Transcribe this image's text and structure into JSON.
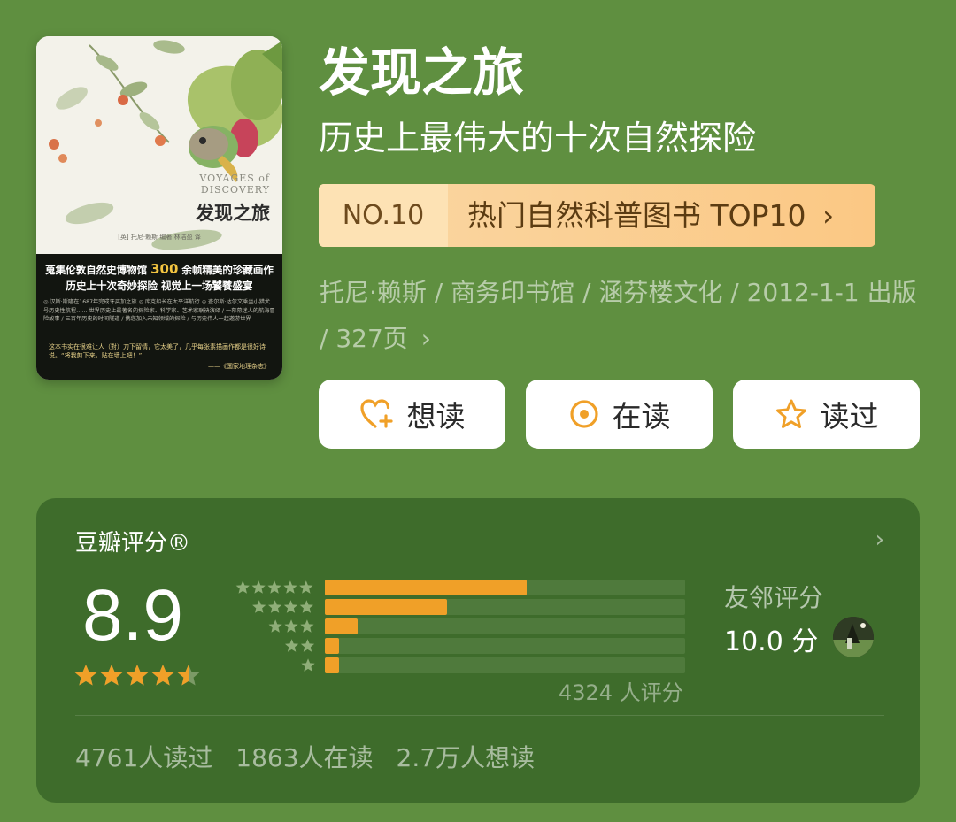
{
  "cover": {
    "title_en": "VOYAGES of DISCOVERY",
    "title_cn": "发现之旅",
    "author_line": "[英] 托尼·赖斯  编著     林洁盈  译",
    "headline_pre": "蒐集伦敦自然史博物馆",
    "headline_number": "300",
    "headline_post": "余帧精美的珍藏画作",
    "headline2": "历史上十次奇妙探险  视觉上一场饕餮盛宴",
    "small_text": "◎ 汉斯·斯隆在1687年完成牙买加之旅  ◎ 库克船长在太平洋航行  ◎ 查尔斯·达尔文乘坐小猎犬号历史性航程……  世界历史上最著名的探险家、科学家、艺术家联袂演绎 / 一幕幕迷人的航海冒险故事 / 三百年历史的时间隧道 / 携您加入未知领域的探险 / 与历史伟人一起邀游世界",
    "quote": "这本书实在很难让人（對）刀下留情，它太美了，几乎每张素描画作都是很好诗说。“将我剪下来，贴在墙上吧！”",
    "quote_source": "——《国家地理杂志》"
  },
  "book": {
    "title": "发现之旅",
    "subtitle": "历史上最伟大的十次自然探险",
    "rank_no": "NO.10",
    "rank_text": "热门自然科普图书 TOP10",
    "rank_arrow": "›",
    "meta_line": "托尼·赖斯 / 商务印书馆 / 涵芬楼文化 / 2012-1-1 出版 / 327页",
    "meta_arrow": "›"
  },
  "actions": [
    {
      "label": "想读",
      "icon": "heart-plus-icon"
    },
    {
      "label": "在读",
      "icon": "circle-dot-icon"
    },
    {
      "label": "读过",
      "icon": "star-outline-icon"
    }
  ],
  "rating": {
    "title": "豆瓣评分®",
    "arrow": "›",
    "score": "8.9",
    "score_value": 8.9,
    "stars_value": 4.5,
    "distribution": [
      {
        "stars": 5,
        "fraction": 0.56
      },
      {
        "stars": 4,
        "fraction": 0.34
      },
      {
        "stars": 3,
        "fraction": 0.09
      },
      {
        "stars": 2,
        "fraction": 0.04
      },
      {
        "stars": 1,
        "fraction": 0.04
      }
    ],
    "count_text": "4324 人评分",
    "friend_label": "友邻评分",
    "friend_score": "10.0 分",
    "stats": [
      "4761人读过",
      "1863人在读",
      "2.7万人想读"
    ]
  },
  "colors": {
    "background": "#5f8f40",
    "card": "#3e6c2b",
    "accent_orange": "#f0a028",
    "rank_bg": "#fbc884",
    "button_icon": "#f0a028"
  }
}
